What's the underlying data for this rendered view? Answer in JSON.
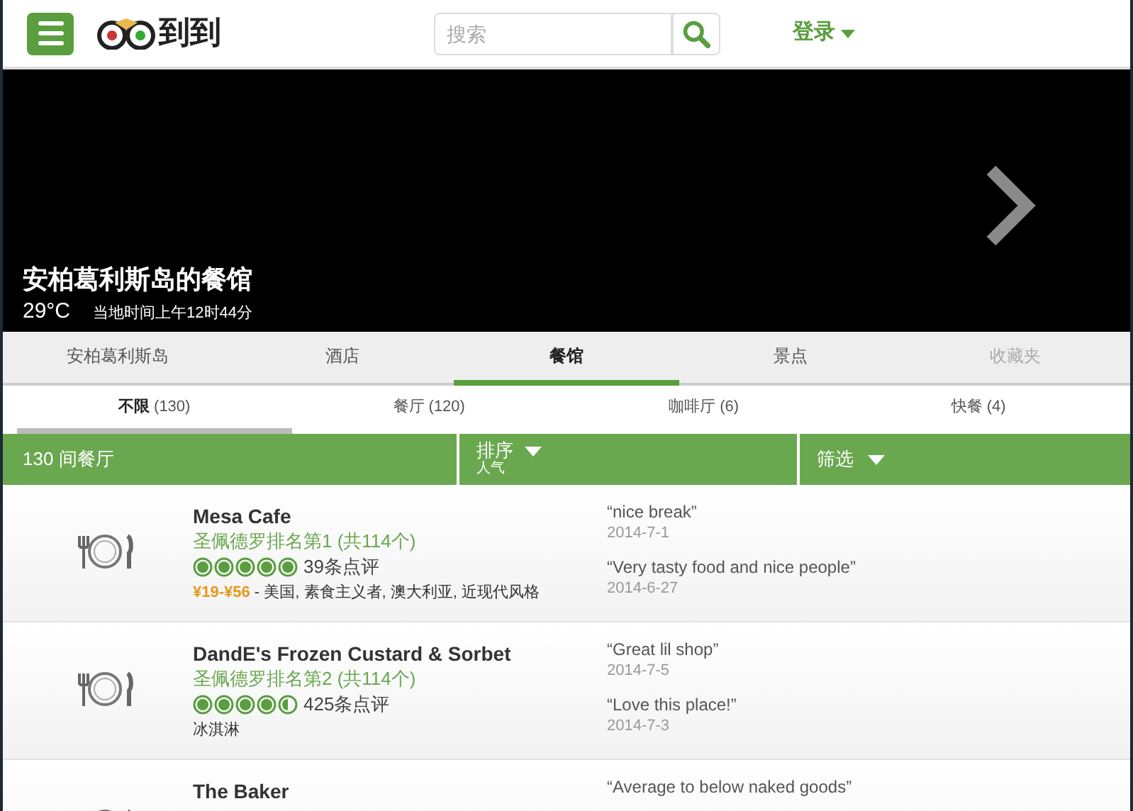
{
  "header": {
    "logo": "到到",
    "search": {
      "placeholder": "搜索"
    },
    "login": "登录"
  },
  "hero": {
    "title": "安柏葛利斯岛的餐馆",
    "temperature": "29°C",
    "local_time": "当地时间上午12时44分"
  },
  "tabs": [
    {
      "label": "安柏葛利斯岛",
      "selected": false,
      "disabled": false
    },
    {
      "label": "酒店",
      "selected": false,
      "disabled": false
    },
    {
      "label": "餐馆",
      "selected": true,
      "disabled": false
    },
    {
      "label": "景点",
      "selected": false,
      "disabled": false
    },
    {
      "label": "收藏夹",
      "selected": false,
      "disabled": true
    }
  ],
  "subtabs": [
    {
      "label": "不限",
      "count": "(130)",
      "selected": true
    },
    {
      "label": "餐厅",
      "count": "(120)",
      "selected": false
    },
    {
      "label": "咖啡厅",
      "count": "(6)",
      "selected": false
    },
    {
      "label": "快餐",
      "count": "(4)",
      "selected": false
    }
  ],
  "filter_bar": {
    "count": "130 间餐厅",
    "sort": {
      "label": "排序",
      "value": "人气"
    },
    "filter": "筛选"
  },
  "restaurants": [
    {
      "name": "Mesa Cafe",
      "rank": "圣佩德罗排名第1 (共114个)",
      "stars": 5,
      "reviews": "39条点评",
      "price": "¥19-¥56",
      "cuisine": " - 美国, 素食主义者, 澳大利亚, 近现代风格",
      "quotes": [
        {
          "text": "“nice break”",
          "date": "2014-7-1"
        },
        {
          "text": "“Very tasty food and nice people”",
          "date": "2014-6-27"
        }
      ]
    },
    {
      "name": "DandE's Frozen Custard & Sorbet",
      "rank": "圣佩德罗排名第2 (共114个)",
      "stars": 4.5,
      "reviews": "425条点评",
      "cuisine": "冰淇淋",
      "quotes": [
        {
          "text": "“Great lil shop”",
          "date": "2014-7-5"
        },
        {
          "text": "“Love this place!”",
          "date": "2014-7-3"
        }
      ]
    },
    {
      "name": "The Baker",
      "quotes": [
        {
          "text": "“Average to below naked goods”"
        }
      ]
    }
  ]
}
